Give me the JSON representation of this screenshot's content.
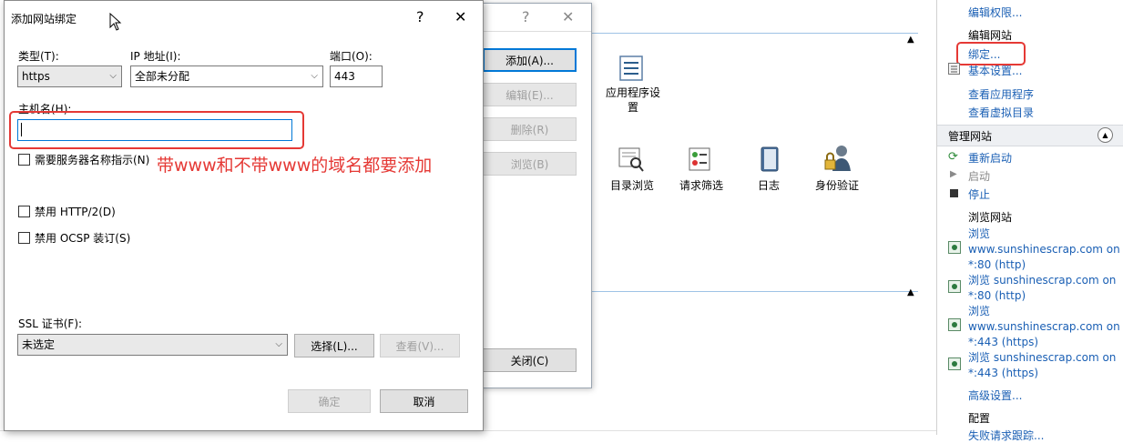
{
  "dialog": {
    "title": "添加网站绑定",
    "help_glyph": "?",
    "close_glyph": "✕",
    "type_label": "类型(T):",
    "type_value": "https",
    "ip_label": "IP 地址(I):",
    "ip_value": "全部未分配",
    "port_label": "端口(O):",
    "port_value": "443",
    "hostname_label": "主机名(H):",
    "hostname_value": "",
    "sni_label": "需要服务器名称指示(N)",
    "http2_label": "禁用 HTTP/2(D)",
    "ocsp_label": "禁用 OCSP 装订(S)",
    "ssl_label": "SSL 证书(F):",
    "ssl_value": "未选定",
    "select_button": "选择(L)...",
    "view_button": "查看(V)...",
    "ok_button": "确定",
    "cancel_button": "取消",
    "annotation": "带www和不带www的域名都要添加"
  },
  "bindings_dialog": {
    "help_glyph": "?",
    "close_glyph": "✕",
    "add_button": "添加(A)...",
    "edit_button": "编辑(E)...",
    "remove_button": "删除(R)",
    "browse_button": "浏览(B)",
    "close_button": "关闭(C)"
  },
  "features": {
    "app_settings": "应用程序设\n置",
    "directory_browsing": "目录浏览",
    "request_filtering": "请求筛选",
    "logging": "日志",
    "authentication": "身份验证"
  },
  "actions": {
    "edit_permissions": "编辑权限...",
    "edit_site_heading": "编辑网站",
    "bindings": "绑定...",
    "basic_settings": "基本设置...",
    "view_applications": "查看应用程序",
    "view_virtual_dirs": "查看虚拟目录",
    "manage_site_heading": "管理网站",
    "restart": "重新启动",
    "start": "启动",
    "stop": "停止",
    "browse_site_heading": "浏览网站",
    "browse_links": [
      "浏览\nwww.sunshinescrap.com on\n*:80 (http)",
      "浏览 sunshinescrap.com on\n*:80 (http)",
      "浏览\nwww.sunshinescrap.com on\n*:443 (https)",
      "浏览 sunshinescrap.com on\n*:443 (https)"
    ],
    "advanced_settings": "高级设置...",
    "config_heading": "配置",
    "limits": "失败请求跟踪..."
  },
  "colors": {
    "highlight_red": "#e53935",
    "link_blue": "#1a5fb4",
    "focus_blue": "#0078d7"
  }
}
